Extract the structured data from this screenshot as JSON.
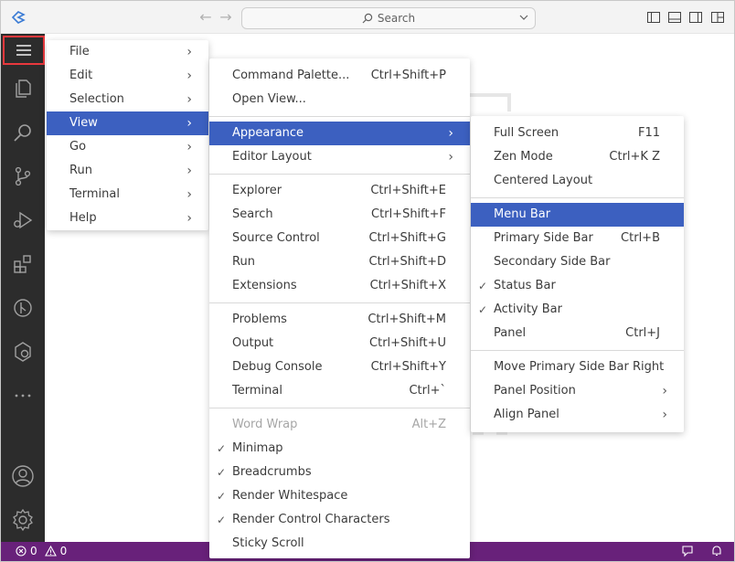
{
  "titlebar": {
    "search_label": "Search"
  },
  "status": {
    "errors": "0",
    "warnings": "0"
  },
  "main_menu": {
    "items": [
      {
        "label": "File"
      },
      {
        "label": "Edit"
      },
      {
        "label": "Selection"
      },
      {
        "label": "View"
      },
      {
        "label": "Go"
      },
      {
        "label": "Run"
      },
      {
        "label": "Terminal"
      },
      {
        "label": "Help"
      }
    ]
  },
  "view_menu": {
    "group1": [
      {
        "label": "Command Palette...",
        "kb": "Ctrl+Shift+P"
      },
      {
        "label": "Open View...",
        "kb": ""
      }
    ],
    "group2": [
      {
        "label": "Appearance",
        "kb": ""
      },
      {
        "label": "Editor Layout",
        "kb": ""
      }
    ],
    "group3": [
      {
        "label": "Explorer",
        "kb": "Ctrl+Shift+E"
      },
      {
        "label": "Search",
        "kb": "Ctrl+Shift+F"
      },
      {
        "label": "Source Control",
        "kb": "Ctrl+Shift+G"
      },
      {
        "label": "Run",
        "kb": "Ctrl+Shift+D"
      },
      {
        "label": "Extensions",
        "kb": "Ctrl+Shift+X"
      }
    ],
    "group4": [
      {
        "label": "Problems",
        "kb": "Ctrl+Shift+M"
      },
      {
        "label": "Output",
        "kb": "Ctrl+Shift+U"
      },
      {
        "label": "Debug Console",
        "kb": "Ctrl+Shift+Y"
      },
      {
        "label": "Terminal",
        "kb": "Ctrl+`"
      }
    ],
    "group5": [
      {
        "label": "Word Wrap",
        "kb": "Alt+Z"
      },
      {
        "label": "Minimap",
        "kb": ""
      },
      {
        "label": "Breadcrumbs",
        "kb": ""
      },
      {
        "label": "Render Whitespace",
        "kb": ""
      },
      {
        "label": "Render Control Characters",
        "kb": ""
      },
      {
        "label": "Sticky Scroll",
        "kb": ""
      }
    ]
  },
  "appearance_menu": {
    "group1": [
      {
        "label": "Full Screen",
        "kb": "F11"
      },
      {
        "label": "Zen Mode",
        "kb": "Ctrl+K Z"
      },
      {
        "label": "Centered Layout",
        "kb": ""
      }
    ],
    "group2": [
      {
        "label": "Menu Bar",
        "kb": ""
      },
      {
        "label": "Primary Side Bar",
        "kb": "Ctrl+B"
      },
      {
        "label": "Secondary Side Bar",
        "kb": ""
      },
      {
        "label": "Status Bar",
        "kb": ""
      },
      {
        "label": "Activity Bar",
        "kb": ""
      },
      {
        "label": "Panel",
        "kb": "Ctrl+J"
      }
    ],
    "group3": [
      {
        "label": "Move Primary Side Bar Right",
        "kb": ""
      },
      {
        "label": "Panel Position",
        "kb": ""
      },
      {
        "label": "Align Panel",
        "kb": ""
      }
    ]
  },
  "colors": {
    "accent": "#3c60c0",
    "statusbar": "#68217a",
    "activitybar": "#2c2c2c",
    "highlight_border": "#e8383d"
  }
}
